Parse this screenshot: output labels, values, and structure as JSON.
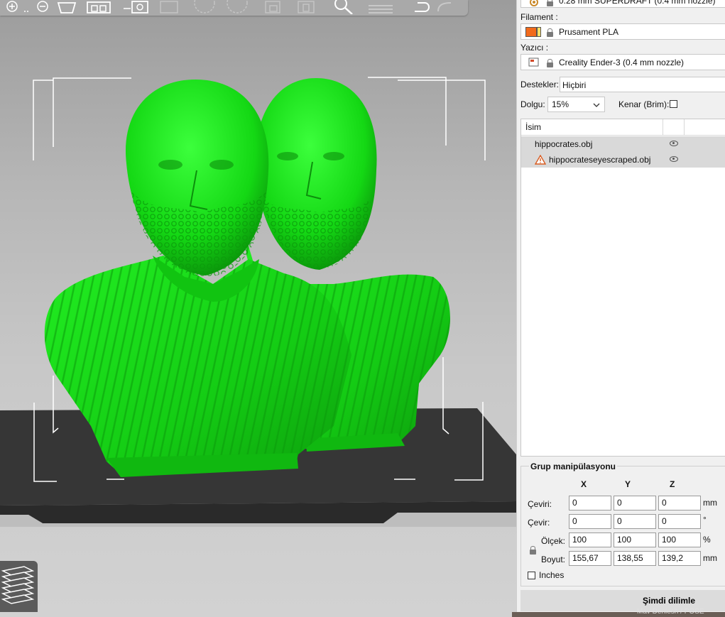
{
  "toolbar": {
    "icons": [
      "zoom-in-icon",
      "zoom-out-icon",
      "object-icon",
      "arrange-icon",
      "search-object-icon",
      "cut-icon",
      "rotate-icon",
      "scale-icon",
      "copy-icon",
      "paste-icon",
      "zoom-icon",
      "layers-icon",
      "undo-icon",
      "redo-icon"
    ]
  },
  "panel": {
    "print_profile": "0.28 mm SUPERDRAFT (0.4 mm nozzle)",
    "filament_label": "Filament :",
    "filament_value": "Prusament PLA",
    "filament_color": "#f26a1b",
    "printer_label": "Yazıcı :",
    "printer_value": "Creality Ender-3 (0.4 mm nozzle)",
    "supports_label": "Destekler:",
    "supports_value": "Hiçbiri",
    "infill_label": "Dolgu:",
    "infill_value": "15%",
    "brim_label": "Kenar (Brim):",
    "brim_checked": false
  },
  "object_list": {
    "header_name": "İsim",
    "items": [
      {
        "name": "hippocrates.obj",
        "warning": false
      },
      {
        "name": "hippocrateseyescraped.obj",
        "warning": true
      }
    ]
  },
  "manipulation": {
    "title": "Grup manipülasyonu",
    "col_x": "X",
    "col_y": "Y",
    "col_z": "Z",
    "rows": [
      {
        "label": "Çeviri:",
        "x": "0",
        "y": "0",
        "z": "0",
        "unit": "mm"
      },
      {
        "label": "Çevir:",
        "x": "0",
        "y": "0",
        "z": "0",
        "unit": "°"
      },
      {
        "label": "Ölçek:",
        "x": "100",
        "y": "100",
        "z": "100",
        "unit": "%"
      },
      {
        "label": "Boyut:",
        "x": "155,67",
        "y": "138,55",
        "z": "139,2",
        "unit": "mm"
      }
    ],
    "inches_label": "Inches",
    "inches_checked": false
  },
  "slice_button": "Şimdi dilimle",
  "bottom_strip_text": "Mav Deniesh / POSE",
  "colors": {
    "model_green": "#1ee81e",
    "bed": "#3a3a3a",
    "accent_orange": "#e8902a"
  }
}
